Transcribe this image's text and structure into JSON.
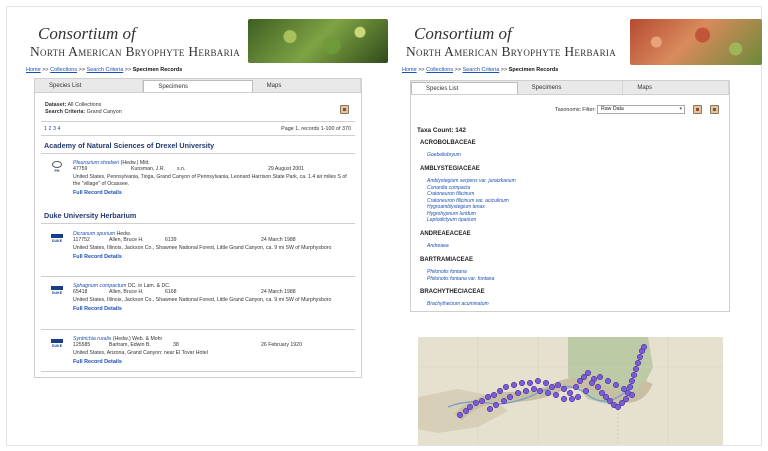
{
  "left": {
    "title_line1": "Consortium of",
    "title_line2": "North American Bryophyte Herbaria",
    "breadcrumb": {
      "home": "Home",
      "collections": "Collections",
      "search": "Search Criteria",
      "current": "Specimen Records",
      "sep": ">>"
    },
    "tabs": [
      "Species List",
      "Specimens",
      "Maps"
    ],
    "dataset_label": "Dataset:",
    "dataset_value": "All Collections",
    "criteria_label": "Search Criteria:",
    "criteria_value": "Grand Canyon",
    "pages": "1 2 3 4",
    "page_info": "Page 1, records 1-100 of 370",
    "institutions": [
      {
        "name": "Academy of Natural Sciences of Drexel University",
        "records": [
          {
            "logo": "PH",
            "species": "Pleurozium shreberi",
            "author": "(Hedw.) Mitt.",
            "catalog": "47759",
            "collector": "Kunsman, J.R.",
            "number": "s.n.",
            "date": "29 August 2001",
            "locality": "United States, Pennsylvania, Tioga, Grand Canyon of Pennsylvania, Leonard Harrison State Park, ca. 1.4 air miles S of the \"village\" of Ocassee.",
            "full": "Full Record Details"
          }
        ]
      },
      {
        "name": "Duke University Herbarium",
        "records": [
          {
            "logo": "DUKE",
            "species": "Dicranum spurium",
            "author": "Hedw.",
            "catalog": "117752",
            "collector": "Allen, Bruce H.",
            "number": "6139",
            "date": "24 March 1988",
            "locality": "United States, Illinois, Jackson Co., Shawnee National Forest, Little Grand Canyon, ca. 9 mi SW of Murphysboro",
            "full": "Full Record Details"
          },
          {
            "logo": "DUKE",
            "species": "Sphagnum compactum",
            "author": "DC. in Lam. & DC.",
            "catalog": "65418",
            "collector": "Allen, Bruce H.",
            "number": "6168",
            "date": "24 March 1988",
            "locality": "United States, Illinois, Jackson Co., Shawnee National Forest, Little Grand Canyon, ca. 9 mi SW of Murphysboro",
            "full": "Full Record Details"
          },
          {
            "logo": "DUKE",
            "species": "Syntrichia ruralis",
            "author": "(Hedw.) Web. & Mohr",
            "catalog": "125585",
            "collector": "Bartram, Edwin B.",
            "number": "38",
            "date": "26 February 1920",
            "locality": "United States, Arizona, Grand Canyon: near El Tovar Hotel",
            "full": "Full Record Details"
          }
        ]
      }
    ]
  },
  "right": {
    "title_line1": "Consortium of",
    "title_line2": "North American Bryophyte Herbaria",
    "breadcrumb": {
      "home": "Home",
      "collections": "Collections",
      "search": "Search Criteria",
      "current": "Specimen Records",
      "sep": ">>"
    },
    "tabs": [
      "Species List",
      "Specimens",
      "Maps"
    ],
    "filter_label": "Taxonomic Filter:",
    "filter_value": "Raw Data",
    "taxa_count": "Taxa Count: 142",
    "families": [
      {
        "name": "ACROBOLBACEAE",
        "taxa": [
          "Goebeliobryum"
        ]
      },
      {
        "name": "AMBLYSTEGIACEAE",
        "taxa": [
          "Amblystegium serpens var. juratzkanum",
          "Conardia compacta",
          "Cratoneuron filicinum",
          "Cratoneuron filicinum var. aciculinum",
          "Hygroamblystegium tenax",
          "Hygrohypnum luridum",
          "Leptodictyum riparium"
        ]
      },
      {
        "name": "ANDREAEACEAE",
        "taxa": [
          "Andreaea"
        ]
      },
      {
        "name": "BARTRAMIACEAE",
        "taxa": [
          "Philonotis fontana",
          "Philonotis fontana var. fontana"
        ]
      },
      {
        "name": "BRACHYTHECIACEAE",
        "taxa": [
          "Brachythecium acuminatum"
        ]
      }
    ]
  },
  "map": {
    "marker_color": "#7b5bd6",
    "marker_count": 60
  }
}
